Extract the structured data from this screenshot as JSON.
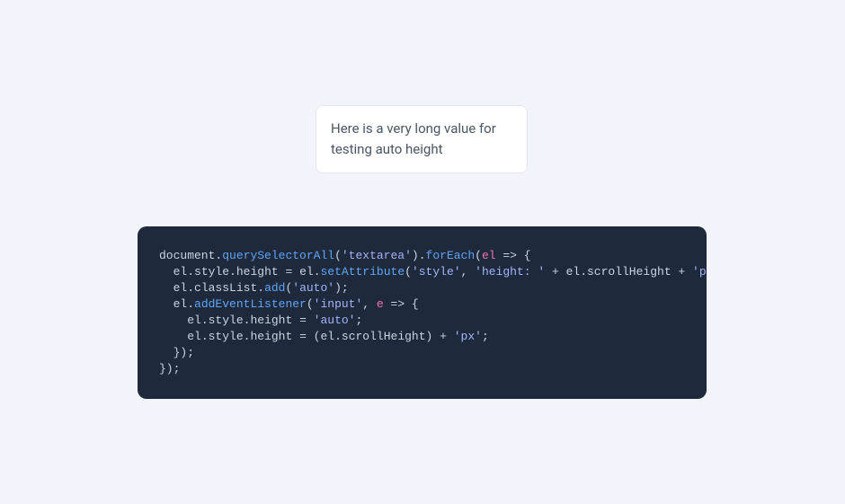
{
  "textarea": {
    "value": "Here is a very long value for testing auto height"
  },
  "code": {
    "lines": [
      [
        {
          "t": "document",
          "c": "tok-default"
        },
        {
          "t": ".",
          "c": "tok-punct"
        },
        {
          "t": "querySelectorAll",
          "c": "tok-method"
        },
        {
          "t": "(",
          "c": "tok-punct"
        },
        {
          "t": "'textarea'",
          "c": "tok-string"
        },
        {
          "t": ")",
          "c": "tok-punct"
        },
        {
          "t": ".",
          "c": "tok-punct"
        },
        {
          "t": "forEach",
          "c": "tok-method"
        },
        {
          "t": "(",
          "c": "tok-punct"
        },
        {
          "t": "el",
          "c": "tok-keyword"
        },
        {
          "t": " ",
          "c": "tok-default"
        },
        {
          "t": "=>",
          "c": "tok-punct"
        },
        {
          "t": " {",
          "c": "tok-punct"
        }
      ],
      [
        {
          "t": "  el",
          "c": "tok-default"
        },
        {
          "t": ".",
          "c": "tok-punct"
        },
        {
          "t": "style",
          "c": "tok-prop"
        },
        {
          "t": ".",
          "c": "tok-punct"
        },
        {
          "t": "height",
          "c": "tok-prop"
        },
        {
          "t": " = ",
          "c": "tok-punct"
        },
        {
          "t": "el",
          "c": "tok-default"
        },
        {
          "t": ".",
          "c": "tok-punct"
        },
        {
          "t": "setAttribute",
          "c": "tok-method"
        },
        {
          "t": "(",
          "c": "tok-punct"
        },
        {
          "t": "'style'",
          "c": "tok-string"
        },
        {
          "t": ", ",
          "c": "tok-punct"
        },
        {
          "t": "'height: '",
          "c": "tok-string"
        },
        {
          "t": " + ",
          "c": "tok-punct"
        },
        {
          "t": "el",
          "c": "tok-default"
        },
        {
          "t": ".",
          "c": "tok-punct"
        },
        {
          "t": "scrollHeight",
          "c": "tok-prop"
        },
        {
          "t": " + ",
          "c": "tok-punct"
        },
        {
          "t": "'px'",
          "c": "tok-string"
        },
        {
          "t": ");",
          "c": "tok-punct"
        }
      ],
      [
        {
          "t": "  el",
          "c": "tok-default"
        },
        {
          "t": ".",
          "c": "tok-punct"
        },
        {
          "t": "classList",
          "c": "tok-prop"
        },
        {
          "t": ".",
          "c": "tok-punct"
        },
        {
          "t": "add",
          "c": "tok-method"
        },
        {
          "t": "(",
          "c": "tok-punct"
        },
        {
          "t": "'auto'",
          "c": "tok-string"
        },
        {
          "t": ");",
          "c": "tok-punct"
        }
      ],
      [
        {
          "t": "  el",
          "c": "tok-default"
        },
        {
          "t": ".",
          "c": "tok-punct"
        },
        {
          "t": "addEventListener",
          "c": "tok-method"
        },
        {
          "t": "(",
          "c": "tok-punct"
        },
        {
          "t": "'input'",
          "c": "tok-string"
        },
        {
          "t": ", ",
          "c": "tok-punct"
        },
        {
          "t": "e",
          "c": "tok-keyword"
        },
        {
          "t": " ",
          "c": "tok-default"
        },
        {
          "t": "=>",
          "c": "tok-punct"
        },
        {
          "t": " {",
          "c": "tok-punct"
        }
      ],
      [
        {
          "t": "    el",
          "c": "tok-default"
        },
        {
          "t": ".",
          "c": "tok-punct"
        },
        {
          "t": "style",
          "c": "tok-prop"
        },
        {
          "t": ".",
          "c": "tok-punct"
        },
        {
          "t": "height",
          "c": "tok-prop"
        },
        {
          "t": " = ",
          "c": "tok-punct"
        },
        {
          "t": "'auto'",
          "c": "tok-string"
        },
        {
          "t": ";",
          "c": "tok-punct"
        }
      ],
      [
        {
          "t": "    el",
          "c": "tok-default"
        },
        {
          "t": ".",
          "c": "tok-punct"
        },
        {
          "t": "style",
          "c": "tok-prop"
        },
        {
          "t": ".",
          "c": "tok-punct"
        },
        {
          "t": "height",
          "c": "tok-prop"
        },
        {
          "t": " = ",
          "c": "tok-punct"
        },
        {
          "t": "(",
          "c": "tok-punct"
        },
        {
          "t": "el",
          "c": "tok-default"
        },
        {
          "t": ".",
          "c": "tok-punct"
        },
        {
          "t": "scrollHeight",
          "c": "tok-prop"
        },
        {
          "t": ")",
          "c": "tok-punct"
        },
        {
          "t": " + ",
          "c": "tok-punct"
        },
        {
          "t": "'px'",
          "c": "tok-string"
        },
        {
          "t": ";",
          "c": "tok-punct"
        }
      ],
      [
        {
          "t": "  });",
          "c": "tok-punct"
        }
      ],
      [
        {
          "t": "});",
          "c": "tok-punct"
        }
      ]
    ]
  }
}
